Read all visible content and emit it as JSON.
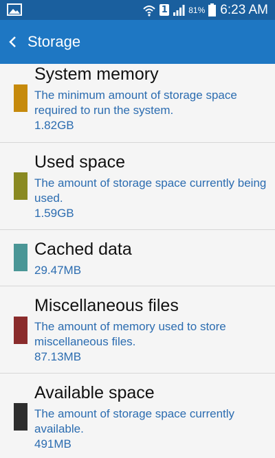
{
  "status_bar": {
    "sim_label": "1",
    "battery_percent": "81%",
    "time": "6:23 AM"
  },
  "app_bar": {
    "title": "Storage"
  },
  "items": [
    {
      "title": "System memory",
      "description": "The minimum amount of storage space required to run the system.",
      "size": "1.82GB",
      "color": "#c68a0c"
    },
    {
      "title": "Used space",
      "description": "The amount of storage space currently being used.",
      "size": "1.59GB",
      "color": "#8a8a22"
    },
    {
      "title": "Cached data",
      "description": "",
      "size": "29.47MB",
      "color": "#4a9696"
    },
    {
      "title": "Miscellaneous files",
      "description": "The amount of memory used to store miscellaneous files.",
      "size": "87.13MB",
      "color": "#8a2c2c"
    },
    {
      "title": "Available space",
      "description": "The amount of storage space currently available.",
      "size": "491MB",
      "color": "#2e2e2e"
    }
  ]
}
